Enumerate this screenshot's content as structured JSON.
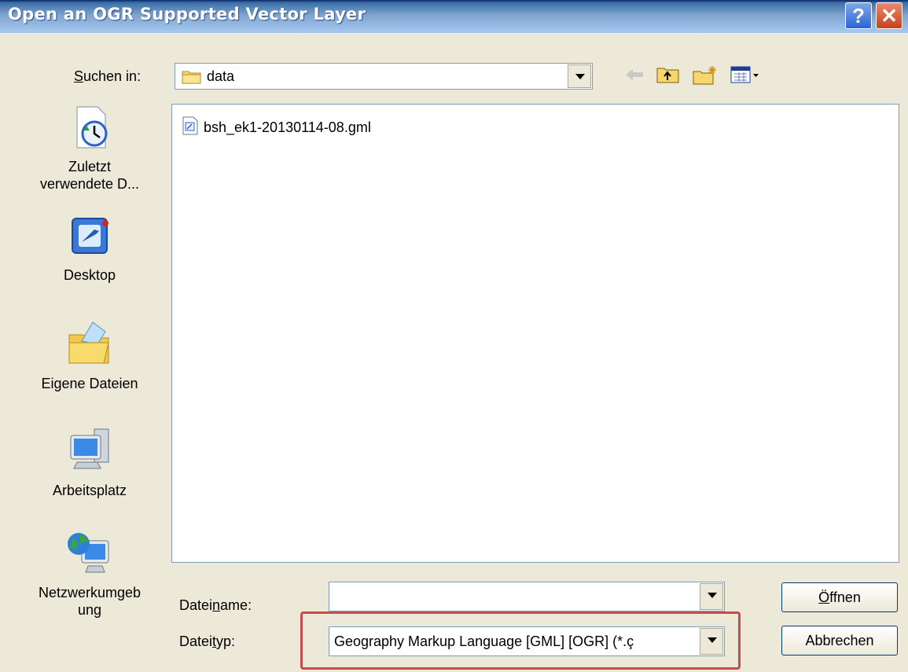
{
  "window": {
    "title": "Open an OGR Supported Vector Layer"
  },
  "titlebar": {
    "help_glyph": "?",
    "close_glyph": "✕"
  },
  "lookin": {
    "label_prefix": "",
    "label_ul": "S",
    "label_rest": "uchen in:",
    "value": "data"
  },
  "toolbar": {
    "icons": [
      "back-icon",
      "up-folder-icon",
      "new-folder-icon",
      "view-menu-icon"
    ]
  },
  "places": [
    {
      "label": "Zuletzt\nverwendete D...",
      "icon": "recent-documents-icon"
    },
    {
      "label": "Desktop",
      "icon": "desktop-icon"
    },
    {
      "label": "Eigene Dateien",
      "icon": "my-documents-icon"
    },
    {
      "label": "Arbeitsplatz",
      "icon": "my-computer-icon"
    },
    {
      "label": "Netzwerkumgeb\nung",
      "icon": "network-icon"
    }
  ],
  "files": [
    {
      "name": "bsh_ek1-20130114-08.gml"
    }
  ],
  "filename": {
    "label_prefix": "Datei",
    "label_ul": "n",
    "label_rest": "ame:",
    "value": ""
  },
  "filetype": {
    "label_prefix": "Datei",
    "label_ul": "t",
    "label_rest": "yp:",
    "value": "Geography Markup Language [GML] [OGR] (*.ç"
  },
  "buttons": {
    "open_ul": "Ö",
    "open_rest": "ffnen",
    "cancel": "Abbrechen"
  },
  "colors": {
    "highlight": "#c74c4c",
    "titlebar": "#3a6ea5"
  }
}
